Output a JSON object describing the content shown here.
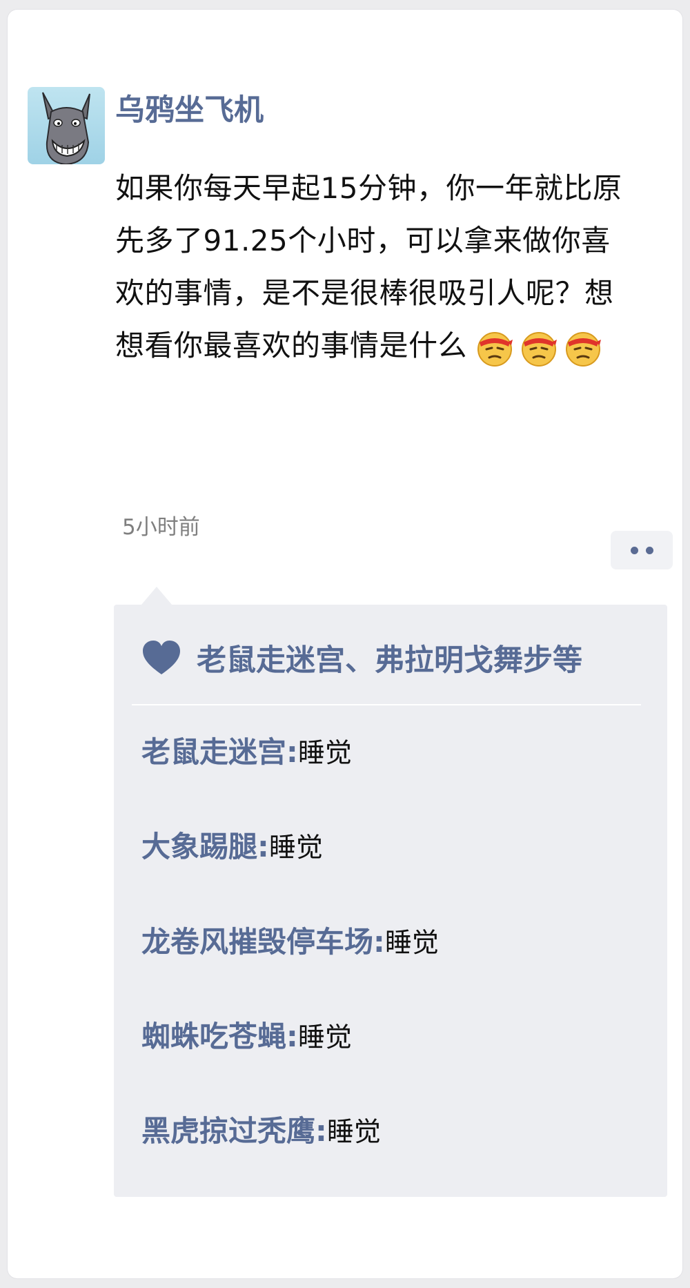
{
  "post": {
    "username": "乌鸦坐飞机",
    "text": "如果你每天早起15分钟，你一年就比原先多了91.25个小时，可以拿来做你喜欢的事情，是不是很棒很吸引人呢？想想看你最喜欢的事情是什么",
    "emoji_icons": [
      "smirk-headband-emoji",
      "smirk-headband-emoji",
      "smirk-headband-emoji"
    ],
    "timestamp": "5小时前"
  },
  "likes": {
    "icon": "heart-icon",
    "names": "老鼠走迷宫、弗拉明戈舞步等"
  },
  "comments": [
    {
      "author": "老鼠走迷宫",
      "separator": ":",
      "text": "睡觉"
    },
    {
      "author": "大象踢腿",
      "separator": ":",
      "text": "睡觉"
    },
    {
      "author": "龙卷风摧毁停车场",
      "separator": ":",
      "text": "睡觉"
    },
    {
      "author": "蜘蛛吃苍蝇",
      "separator": ":",
      "text": "睡觉"
    },
    {
      "author": "黑虎掠过秃鹰",
      "separator": ":",
      "text": "睡觉"
    }
  ],
  "colors": {
    "link_blue": "#576b95",
    "panel_bg": "#edeef2",
    "text": "#111111",
    "timestamp": "#7f7f7f"
  }
}
